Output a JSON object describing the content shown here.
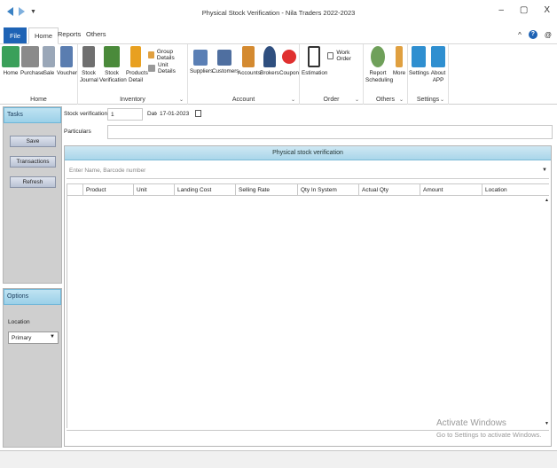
{
  "window": {
    "title": "Physical Stock Verification - Nila Traders 2022-2023",
    "minimize": "–",
    "maximize": "▢",
    "close": "X",
    "quick_access_dropdown": "▼"
  },
  "menu": {
    "file": "File",
    "tabs": [
      "Home",
      "Reports",
      "Others"
    ],
    "caret": "^",
    "help": "?",
    "at": "@"
  },
  "ribbon": {
    "groups": {
      "home": {
        "label": "Home",
        "buttons": [
          "Home",
          "Purchase",
          "Sale",
          "Voucher"
        ]
      },
      "inventory": {
        "label": "Inventory",
        "buttons": [
          "Stock Journal",
          "Stock Verification",
          "Products Detail"
        ],
        "small_buttons": [
          "Group Details",
          "Unit Details"
        ]
      },
      "account": {
        "label": "Account",
        "buttons": [
          "Suppliers",
          "Customers",
          "Accounts",
          "Brokers",
          "Coupon"
        ]
      },
      "order": {
        "label": "Order",
        "buttons": [
          "Estimation"
        ],
        "small_buttons": [
          "Work Order"
        ]
      },
      "others": {
        "label": "Others",
        "buttons": [
          "Report Scheduling",
          "More"
        ]
      },
      "settings": {
        "label": "Settings",
        "buttons": [
          "Settings",
          "About APP"
        ]
      }
    },
    "colors": {
      "home": "#3aa05a",
      "purchase": "#8a8a8a",
      "sale": "#9aa7b8",
      "voucher": "#5a7db0",
      "stock_journal": "#6f6f6f",
      "stock_verification": "#4a8a3a",
      "products_detail": "#e8a020",
      "suppliers": "#5a7fb5",
      "customers": "#4f6fa0",
      "accounts": "#d48a30",
      "brokers": "#2f4f7f",
      "coupon": "#e0302f",
      "estimation": "#333333",
      "report": "#6fa05a",
      "more": "#e0a040",
      "settings": "#2f8fd0",
      "about": "#2f8fd0"
    }
  },
  "left_panel": {
    "tasks_header": "Tasks",
    "buttons": [
      "Save",
      "Transactions",
      "Refresh"
    ],
    "options_header": "Options",
    "location_label": "Location",
    "location_value": "Primary"
  },
  "form": {
    "stock_verification_no_label": "Stock verification no",
    "stock_verification_no_value": "1",
    "date_label": "Date",
    "date_value": "17-01-2023",
    "particulars_label": "Particulars",
    "particulars_value": ""
  },
  "grid": {
    "title": "Physical stock verification",
    "search_placeholder": "Enter Name, Barcode number",
    "columns": [
      "Product",
      "Unit",
      "Landing Cost",
      "Selling Rate",
      "Qty In System",
      "Actual Qty",
      "Amount",
      "Location"
    ]
  },
  "watermark": {
    "line1": "Activate Windows",
    "line2": "Go to Settings to activate Windows."
  }
}
